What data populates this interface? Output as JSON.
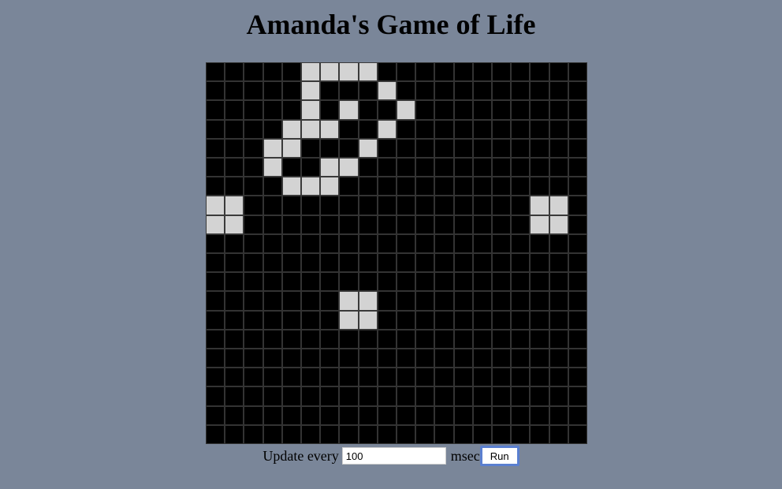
{
  "page": {
    "title": "Amanda's Game of Life"
  },
  "board": {
    "rows": 20,
    "cols": 20,
    "alive_color": "#d3d3d3",
    "dead_color": "#000000",
    "grid_line_color": "#333333",
    "live_cells": [
      [
        0,
        5
      ],
      [
        0,
        6
      ],
      [
        0,
        7
      ],
      [
        0,
        8
      ],
      [
        1,
        5
      ],
      [
        1,
        9
      ],
      [
        2,
        5
      ],
      [
        2,
        7
      ],
      [
        2,
        10
      ],
      [
        3,
        4
      ],
      [
        3,
        5
      ],
      [
        3,
        6
      ],
      [
        3,
        9
      ],
      [
        4,
        3
      ],
      [
        4,
        4
      ],
      [
        4,
        8
      ],
      [
        5,
        3
      ],
      [
        5,
        6
      ],
      [
        5,
        7
      ],
      [
        6,
        4
      ],
      [
        6,
        5
      ],
      [
        6,
        6
      ],
      [
        7,
        0
      ],
      [
        7,
        1
      ],
      [
        7,
        17
      ],
      [
        7,
        18
      ],
      [
        8,
        0
      ],
      [
        8,
        1
      ],
      [
        8,
        17
      ],
      [
        8,
        18
      ],
      [
        12,
        7
      ],
      [
        12,
        8
      ],
      [
        13,
        7
      ],
      [
        13,
        8
      ]
    ]
  },
  "controls": {
    "update_label": "Update every",
    "interval_value": "100",
    "unit_label": "msec",
    "run_label": "Run"
  },
  "colors": {
    "background": "#7a8699",
    "run_button_focus": "#5a7fd0"
  }
}
